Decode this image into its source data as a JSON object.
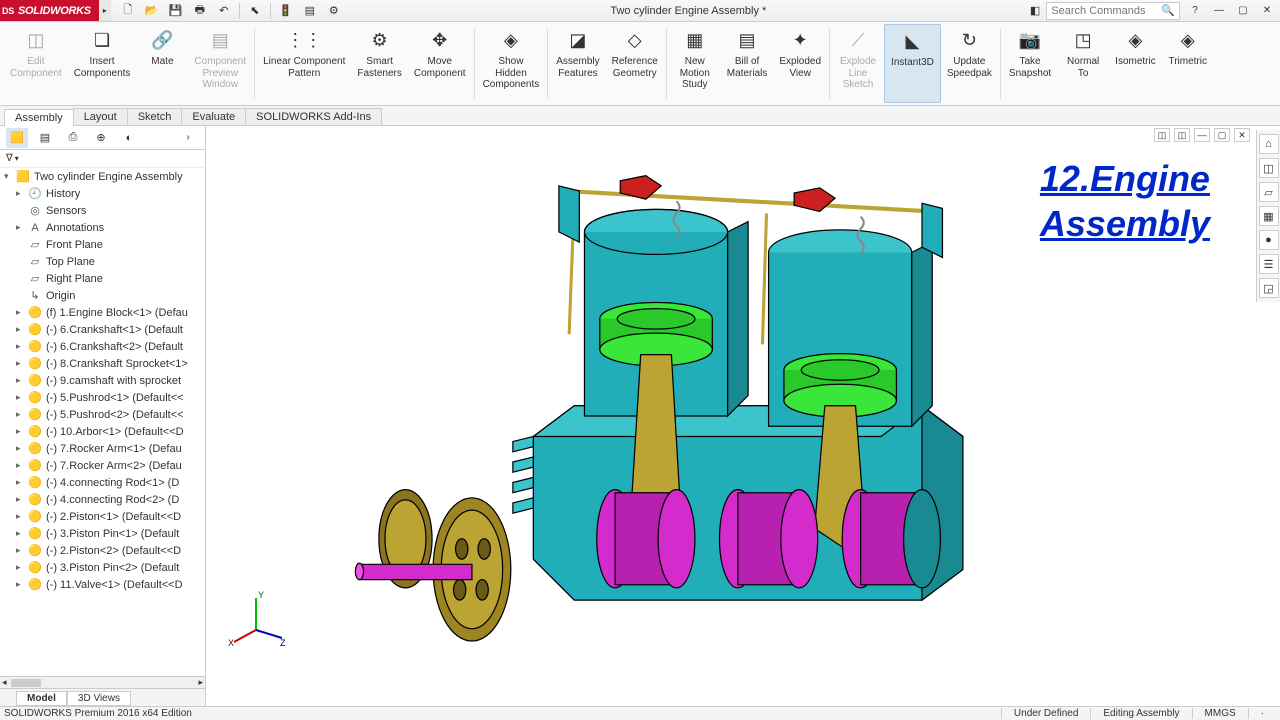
{
  "app": {
    "logo": "SOLIDWORKS",
    "doc_title": "Two cylinder Engine Assembly *",
    "search_placeholder": "Search Commands"
  },
  "qat": [
    "new",
    "open",
    "save",
    "print",
    "undo",
    "select",
    "rebuild",
    "options",
    "settings"
  ],
  "ribbon": [
    {
      "id": "edit-component",
      "label": "Edit\nComponent",
      "disabled": true,
      "icon": "◫"
    },
    {
      "id": "insert-components",
      "label": "Insert\nComponents",
      "icon": "❏"
    },
    {
      "id": "mate",
      "label": "Mate",
      "icon": "🔗"
    },
    {
      "id": "component-preview",
      "label": "Component\nPreview\nWindow",
      "disabled": true,
      "icon": "▤"
    },
    {
      "id": "linear-pattern",
      "label": "Linear Component\nPattern",
      "icon": "⋮⋮"
    },
    {
      "id": "smart-fasteners",
      "label": "Smart\nFasteners",
      "icon": "⚙"
    },
    {
      "id": "move-component",
      "label": "Move\nComponent",
      "icon": "✥"
    },
    {
      "id": "show-hidden",
      "label": "Show\nHidden\nComponents",
      "icon": "◈"
    },
    {
      "id": "assembly-features",
      "label": "Assembly\nFeatures",
      "icon": "◪"
    },
    {
      "id": "reference-geometry",
      "label": "Reference\nGeometry",
      "icon": "◇"
    },
    {
      "id": "new-motion",
      "label": "New\nMotion\nStudy",
      "icon": "▦"
    },
    {
      "id": "bom",
      "label": "Bill of\nMaterials",
      "icon": "▤"
    },
    {
      "id": "exploded-view",
      "label": "Exploded\nView",
      "icon": "✦"
    },
    {
      "id": "explode-line",
      "label": "Explode\nLine\nSketch",
      "disabled": true,
      "icon": "⟋"
    },
    {
      "id": "instant3d",
      "label": "Instant3D",
      "active": true,
      "icon": "◣"
    },
    {
      "id": "update-speedpak",
      "label": "Update\nSpeedpak",
      "icon": "↻"
    },
    {
      "id": "take-snapshot",
      "label": "Take\nSnapshot",
      "icon": "📷"
    },
    {
      "id": "normal-to",
      "label": "Normal\nTo",
      "icon": "◳"
    },
    {
      "id": "isometric",
      "label": "Isometric",
      "icon": "◈"
    },
    {
      "id": "trimetric",
      "label": "Trimetric",
      "icon": "◈"
    }
  ],
  "tabs": [
    "Assembly",
    "Layout",
    "Sketch",
    "Evaluate",
    "SOLIDWORKS Add-Ins"
  ],
  "active_tab": "Assembly",
  "tree_root": "Two cylinder Engine Assembly",
  "tree": [
    {
      "label": "History",
      "icon": "🕘",
      "sub": true,
      "exp": "▸"
    },
    {
      "label": "Sensors",
      "icon": "◎",
      "sub": true
    },
    {
      "label": "Annotations",
      "icon": "A",
      "sub": true,
      "exp": "▸"
    },
    {
      "label": "Front Plane",
      "icon": "▱",
      "sub": true
    },
    {
      "label": "Top Plane",
      "icon": "▱",
      "sub": true
    },
    {
      "label": "Right Plane",
      "icon": "▱",
      "sub": true
    },
    {
      "label": "Origin",
      "icon": "↳",
      "sub": true
    },
    {
      "label": "(f) 1.Engine Block<1> (Defau",
      "icon": "🟡",
      "sub": true,
      "exp": "▸"
    },
    {
      "label": "(-) 6.Crankshaft<1> (Default",
      "icon": "🟡",
      "sub": true,
      "exp": "▸"
    },
    {
      "label": "(-) 6.Crankshaft<2> (Default",
      "icon": "🟡",
      "sub": true,
      "exp": "▸"
    },
    {
      "label": "(-) 8.Crankshaft Sprocket<1>",
      "icon": "🟡",
      "sub": true,
      "exp": "▸"
    },
    {
      "label": "(-) 9.camshaft with sprocket",
      "icon": "🟡",
      "sub": true,
      "exp": "▸"
    },
    {
      "label": "(-) 5.Pushrod<1> (Default<<",
      "icon": "🟡",
      "sub": true,
      "exp": "▸"
    },
    {
      "label": "(-) 5.Pushrod<2> (Default<<",
      "icon": "🟡",
      "sub": true,
      "exp": "▸"
    },
    {
      "label": "(-) 10.Arbor<1> (Default<<D",
      "icon": "🟡",
      "sub": true,
      "exp": "▸"
    },
    {
      "label": "(-) 7.Rocker Arm<1> (Defau",
      "icon": "🟡",
      "sub": true,
      "exp": "▸"
    },
    {
      "label": "(-) 7.Rocker Arm<2> (Defau",
      "icon": "🟡",
      "sub": true,
      "exp": "▸"
    },
    {
      "label": "(-) 4.connecting Rod<1> (D",
      "icon": "🟡",
      "sub": true,
      "exp": "▸"
    },
    {
      "label": "(-) 4.connecting Rod<2> (D",
      "icon": "🟡",
      "sub": true,
      "exp": "▸"
    },
    {
      "label": "(-) 2.Piston<1> (Default<<D",
      "icon": "🟡",
      "sub": true,
      "exp": "▸"
    },
    {
      "label": "(-) 3.Piston Pin<1> (Default",
      "icon": "🟡",
      "sub": true,
      "exp": "▸"
    },
    {
      "label": "(-) 2.Piston<2> (Default<<D",
      "icon": "🟡",
      "sub": true,
      "exp": "▸"
    },
    {
      "label": "(-) 3.Piston Pin<2> (Default",
      "icon": "🟡",
      "sub": true,
      "exp": "▸"
    },
    {
      "label": "(-) 11.Valve<1> (Default<<D",
      "icon": "🟡",
      "sub": true,
      "exp": "▸"
    }
  ],
  "bottom_tabs": [
    "Model",
    "3D Views"
  ],
  "overlay": {
    "line1": "12.Engine",
    "line2": "Assembly"
  },
  "status": {
    "left": "SOLIDWORKS Premium 2016 x64 Edition",
    "def": "Under Defined",
    "mode": "Editing Assembly",
    "units": "MMGS"
  },
  "right_tools": [
    "⌂",
    "◫",
    "▱",
    "▦",
    "●",
    "☰",
    "◲"
  ]
}
